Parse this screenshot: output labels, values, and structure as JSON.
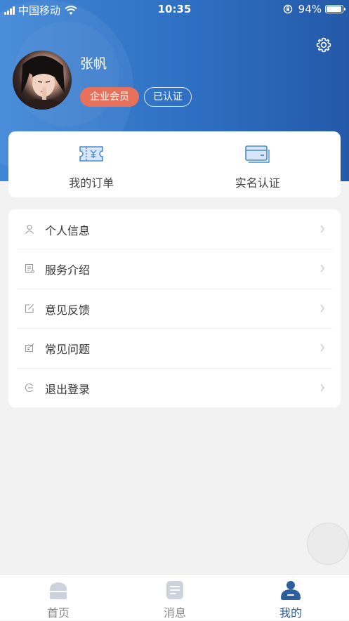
{
  "status_bar": {
    "carrier": "中国移动",
    "time": "10:35",
    "battery_pct": "94%",
    "battery_level": 0.94
  },
  "header": {
    "settings_icon": "gear-icon",
    "username": "张帆",
    "member_badge": "企业会员",
    "verified_badge": "已认证",
    "colors": {
      "gradient_start": "#3f86d6",
      "gradient_end": "#2459a8",
      "member_badge": "#e7715a"
    }
  },
  "actions": [
    {
      "label": "我的订单",
      "icon": "ticket-yuan-icon"
    },
    {
      "label": "实名认证",
      "icon": "id-card-icon"
    }
  ],
  "menu": [
    {
      "label": "个人信息",
      "icon": "user-icon"
    },
    {
      "label": "服务介绍",
      "icon": "document-icon"
    },
    {
      "label": "意见反馈",
      "icon": "edit-icon"
    },
    {
      "label": "常见问题",
      "icon": "note-edit-icon"
    },
    {
      "label": "退出登录",
      "icon": "logout-icon"
    }
  ],
  "tabs": [
    {
      "label": "首页",
      "icon": "home-icon",
      "active": false
    },
    {
      "label": "消息",
      "icon": "message-icon",
      "active": false
    },
    {
      "label": "我的",
      "icon": "profile-icon",
      "active": true
    }
  ],
  "accent_color": "#2c5f9b"
}
